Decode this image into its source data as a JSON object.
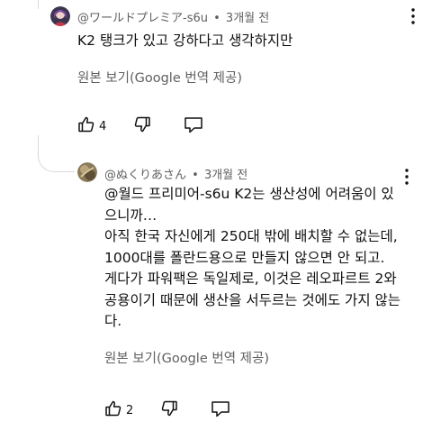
{
  "comments": [
    {
      "author": "@ワールドプレミア-s6u",
      "time": "3개월 전",
      "text": "K2 탱크가 있고 강하다고 생각하지만",
      "translate_label": "원본 보기(Google 번역 제공)",
      "like_count": "4",
      "icons": {
        "like": "thumbs-up-icon",
        "dislike": "thumbs-down-icon",
        "reply": "reply-icon",
        "more": "more-vert-icon"
      }
    },
    {
      "author": "@ぬくりあさん",
      "time": "3개월 전",
      "text": "@월드 프리미어-s6u K2는 생산성에 어려움이 있\n으니까…\n아직 한국 자신에게 250대 밖에 배치할 수 없는데,\n1000대를 폴란드용으로 만들지 않으면 안 되고.\n게다가 파워팩은 독일제로, 이것은 레오파르트 2와\n공용이기 때문에 생산을 서두르는 것에도 가지 않는\n다.",
      "translate_label": "원본 보기(Google 번역 제공)",
      "like_count": "2",
      "icons": {
        "like": "thumbs-up-icon",
        "dislike": "thumbs-down-icon",
        "reply": "reply-icon",
        "more": "more-vert-icon"
      }
    }
  ]
}
